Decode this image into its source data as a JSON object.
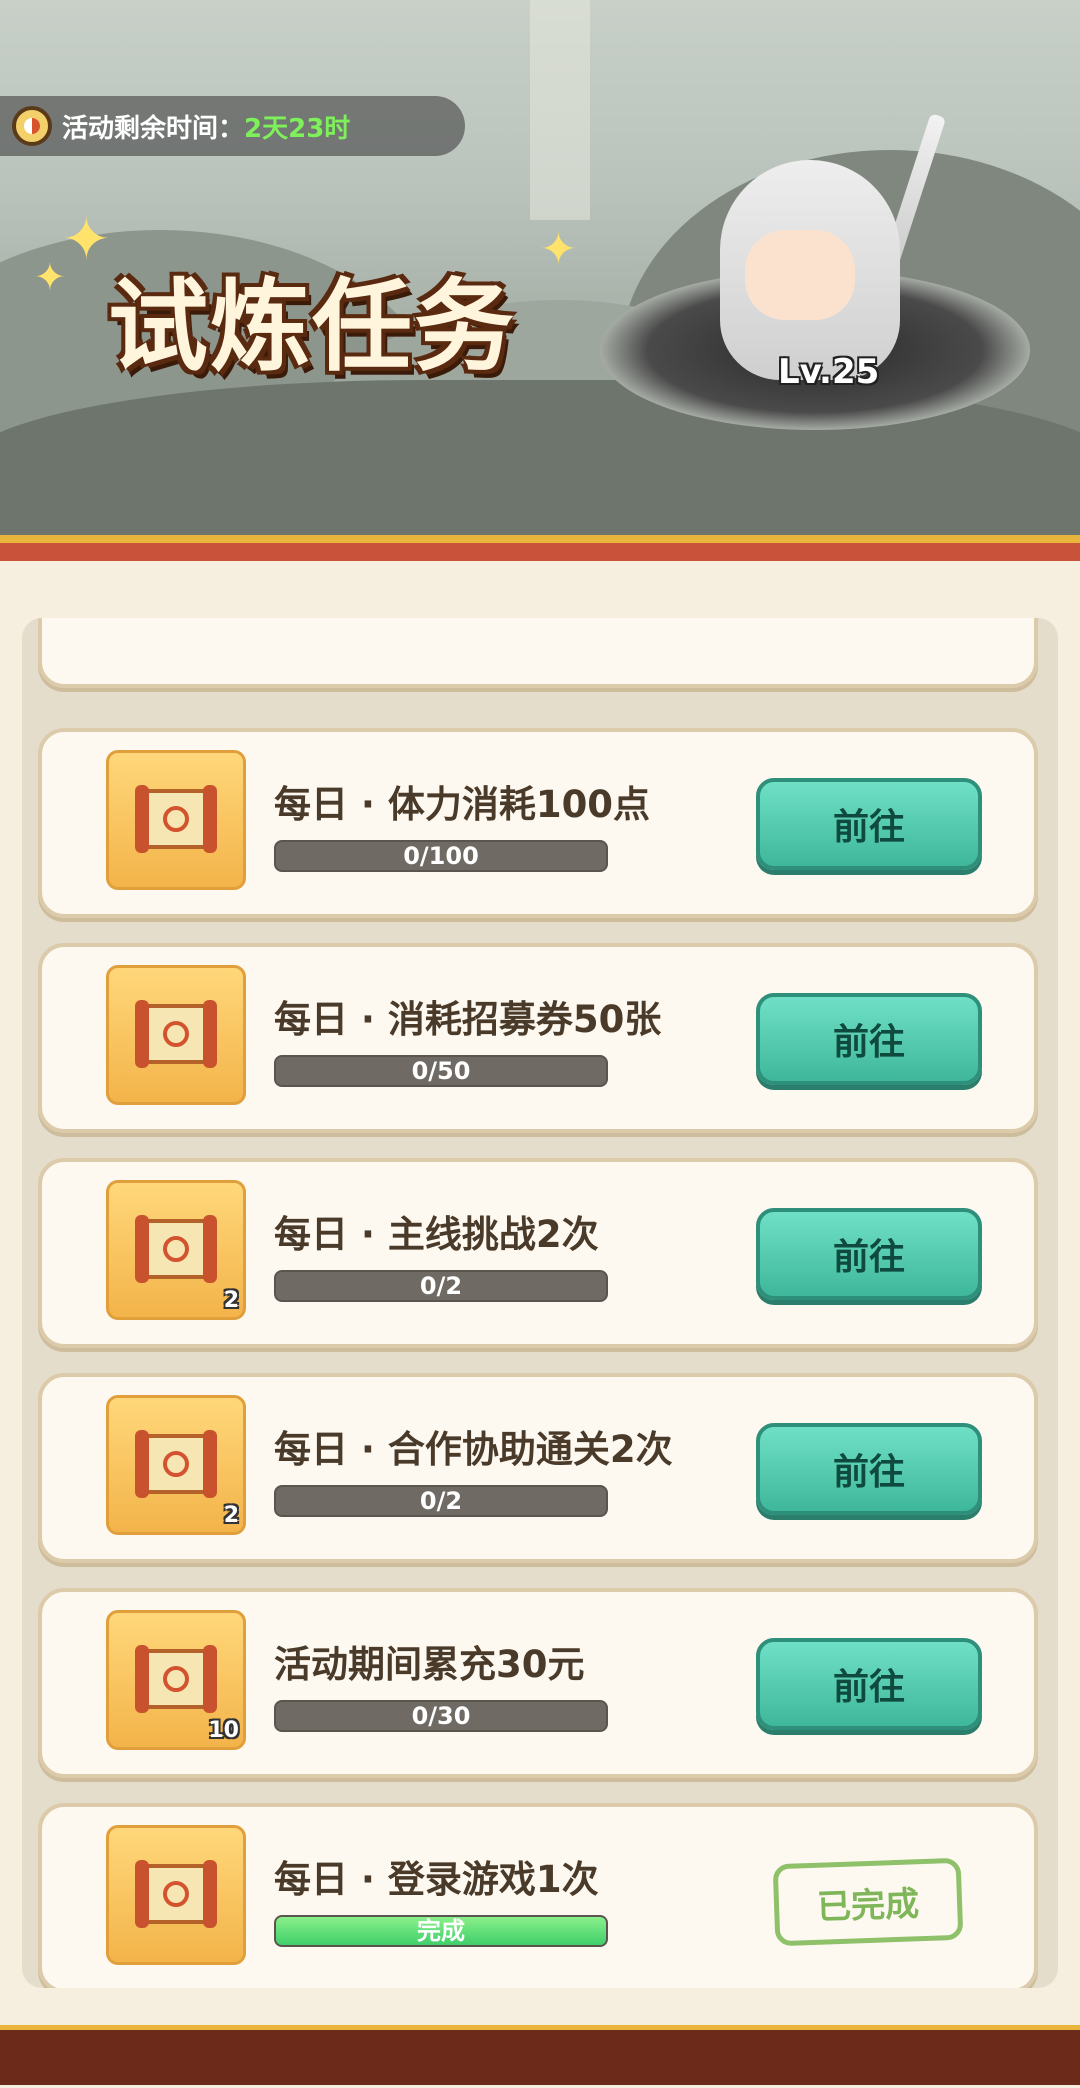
{
  "banner": {
    "timer_label": "活动剩余时间：",
    "timer_value": "2天23时",
    "title": "试炼任务",
    "hero_level": "Lv.25"
  },
  "tasks": [
    {
      "title": "每日 · 体力消耗100点",
      "progress": "0/100",
      "fill": 0,
      "badge": "",
      "action": "前往"
    },
    {
      "title": "每日 · 消耗招募券50张",
      "progress": "0/50",
      "fill": 0,
      "badge": "",
      "action": "前往"
    },
    {
      "title": "每日 · 主线挑战2次",
      "progress": "0/2",
      "fill": 0,
      "badge": "2",
      "action": "前往"
    },
    {
      "title": "每日 · 合作协助通关2次",
      "progress": "0/2",
      "fill": 0,
      "badge": "2",
      "action": "前往"
    },
    {
      "title": "活动期间累充30元",
      "progress": "0/30",
      "fill": 0,
      "badge": "10",
      "action": "前往"
    },
    {
      "title": "每日 · 登录游戏1次",
      "progress": "完成",
      "fill": 1,
      "badge": "",
      "action": "已完成"
    }
  ]
}
